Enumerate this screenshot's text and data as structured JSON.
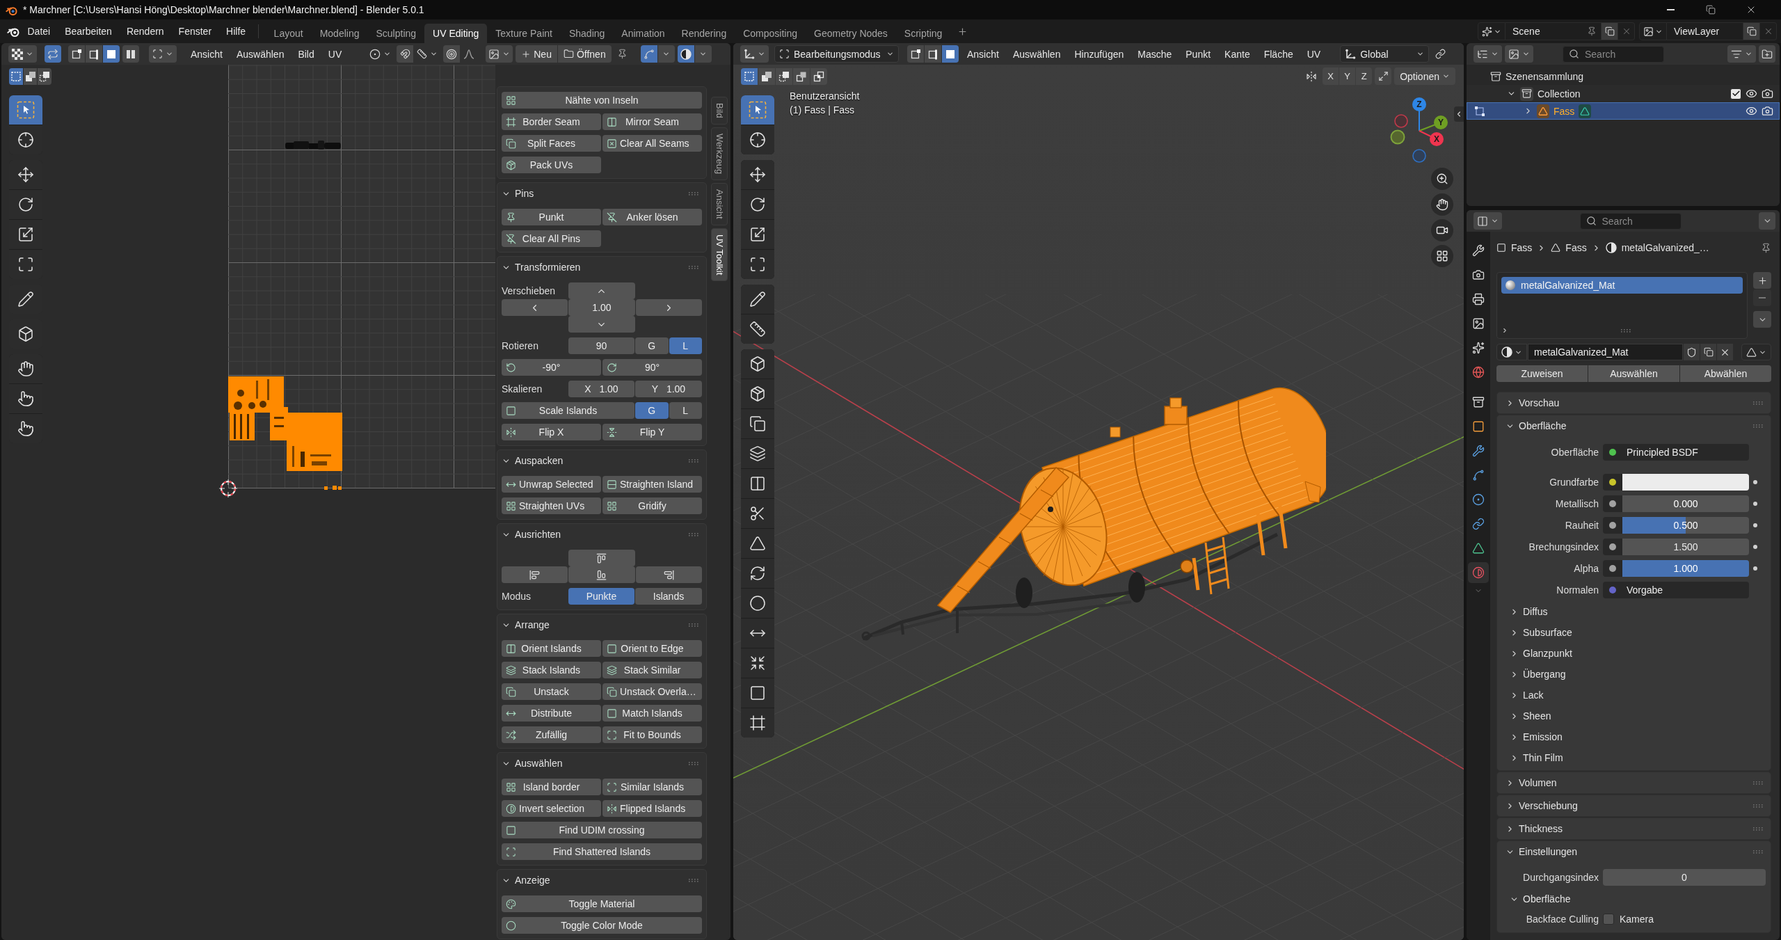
{
  "window": {
    "title": "* Marchner [C:\\Users\\Hansi Höng\\Desktop\\Marchner blender\\Marchner.blend] - Blender 5.0.1"
  },
  "menu": [
    "Datei",
    "Bearbeiten",
    "Rendern",
    "Fenster",
    "Hilfe"
  ],
  "workspaces": [
    {
      "label": "Layout",
      "selected": false
    },
    {
      "label": "Modeling",
      "selected": false
    },
    {
      "label": "Sculpting",
      "selected": false
    },
    {
      "label": "UV Editing",
      "selected": true
    },
    {
      "label": "Texture Paint",
      "selected": false
    },
    {
      "label": "Shading",
      "selected": false
    },
    {
      "label": "Animation",
      "selected": false
    },
    {
      "label": "Rendering",
      "selected": false
    },
    {
      "label": "Compositing",
      "selected": false
    },
    {
      "label": "Geometry Nodes",
      "selected": false
    },
    {
      "label": "Scripting",
      "selected": false
    }
  ],
  "scene": "Scene",
  "view_layer": "ViewLayer",
  "uv_editor": {
    "header": {
      "sync_selection": true,
      "select_modes": [
        {
          "selected": false
        },
        {
          "selected": false
        },
        {
          "selected": true
        },
        {
          "selected": false
        }
      ],
      "menus": [
        "Ansicht",
        "Auswählen",
        "Bild",
        "UV"
      ],
      "new_label": "Neu",
      "open_label": "Öffnen",
      "display_toggles": [
        {
          "on": true
        },
        {
          "on": true
        }
      ]
    },
    "tool_modes": [
      {
        "selected": true
      },
      {
        "selected": false
      },
      {
        "selected": false
      }
    ],
    "tools": [
      {
        "selected": true
      },
      {
        "selected": false
      },
      {
        "selected": false
      },
      {
        "selected": false
      },
      {
        "selected": false
      },
      {
        "selected": false
      },
      {
        "selected": false
      },
      {
        "selected": false
      },
      {
        "selected": false
      },
      {
        "selected": false
      },
      {
        "selected": false
      }
    ],
    "sidebar_tabs": [
      {
        "label": "Bild",
        "selected": false
      },
      {
        "label": "Werkzeug",
        "selected": false
      },
      {
        "label": "Ansicht",
        "selected": false
      },
      {
        "label": "UV Toolkit",
        "selected": true
      }
    ],
    "panels": [
      {
        "rows": [
          {
            "kind": "wide",
            "cells": [
              {
                "kind": "button",
                "label": "Nähte von Inseln",
                "icon": true
              }
            ]
          },
          {
            "kind": "pair",
            "cells": [
              {
                "kind": "button",
                "label": "Border Seam",
                "icon": true
              },
              {
                "kind": "button",
                "label": "Mirror Seam",
                "icon": true
              }
            ]
          },
          {
            "kind": "pair",
            "cells": [
              {
                "kind": "button",
                "label": "Split Faces",
                "icon": true
              },
              {
                "kind": "button",
                "label": "Clear All Seams",
                "icon": true
              }
            ]
          },
          {
            "kind": "pair",
            "cells": [
              {
                "kind": "button",
                "label": "Pack UVs",
                "icon": true
              }
            ]
          }
        ]
      },
      {
        "title": "Pins",
        "expanded": true,
        "rows": [
          {
            "kind": "pair",
            "cells": [
              {
                "kind": "button",
                "label": "Punkt",
                "icon": true
              },
              {
                "kind": "button",
                "label": "Anker lösen",
                "icon": true
              }
            ]
          },
          {
            "kind": "pair",
            "cells": [
              {
                "kind": "button",
                "label": "Clear All Pins",
                "icon": true
              }
            ]
          }
        ]
      },
      {
        "title": "Transformieren",
        "expanded": true,
        "rows": [
          {
            "kind": "pad",
            "label": "Verschieben",
            "cells": [
              {
                "kind": "icon"
              },
              {
                "kind": "icon"
              },
              {
                "kind": "value",
                "text": "1.00"
              },
              {
                "kind": "icon"
              },
              {
                "kind": "icon"
              }
            ]
          },
          {
            "kind": "quad",
            "label": "Rotieren",
            "cells": [
              {
                "kind": "value",
                "text": "90"
              },
              {
                "kind": "button",
                "label": "G",
                "selected": false
              },
              {
                "kind": "button",
                "label": "L",
                "selected": true
              }
            ]
          },
          {
            "kind": "pair",
            "cells": [
              {
                "kind": "button",
                "label": "-90°",
                "icon": true
              },
              {
                "kind": "button",
                "label": "90°",
                "icon": true
              }
            ]
          },
          {
            "kind": "quad",
            "label": "Skalieren",
            "cells": [
              {
                "kind": "value",
                "name": "X",
                "text": "1.00"
              },
              {
                "kind": "value",
                "name": "Y",
                "text": "1.00"
              }
            ]
          },
          {
            "kind": "quad",
            "cells": [
              {
                "kind": "button",
                "label": "Scale Islands",
                "icon": true
              },
              {
                "kind": "button",
                "label": "G",
                "selected": true
              },
              {
                "kind": "button",
                "label": "L",
                "selected": false
              }
            ]
          },
          {
            "kind": "pair",
            "cells": [
              {
                "kind": "button",
                "label": "Flip X",
                "icon": true
              },
              {
                "kind": "button",
                "label": "Flip Y",
                "icon": true
              }
            ]
          }
        ]
      },
      {
        "title": "Auspacken",
        "expanded": true,
        "rows": [
          {
            "kind": "pair",
            "cells": [
              {
                "kind": "button",
                "label": "Unwrap Selected",
                "icon": true
              },
              {
                "kind": "button",
                "label": "Straighten Island",
                "icon": true
              }
            ]
          },
          {
            "kind": "pair",
            "cells": [
              {
                "kind": "button",
                "label": "Straighten UVs",
                "icon": true
              },
              {
                "kind": "button",
                "label": "Gridify",
                "icon": true
              }
            ]
          }
        ]
      },
      {
        "title": "Ausrichten",
        "expanded": true,
        "rows": [
          {
            "kind": "align",
            "cells": [
              {
                "kind": "icon"
              },
              {
                "kind": "icon"
              },
              {
                "kind": "icon"
              },
              {
                "kind": "icon"
              }
            ]
          },
          {
            "kind": "quad",
            "label": "Modus",
            "cells": [
              {
                "kind": "button",
                "label": "Punkte",
                "selected": true
              },
              {
                "kind": "button",
                "label": "Islands",
                "selected": false
              }
            ]
          }
        ]
      },
      {
        "title": "Arrange",
        "expanded": true,
        "rows": [
          {
            "kind": "pair",
            "cells": [
              {
                "kind": "button",
                "label": "Orient Islands",
                "icon": true
              },
              {
                "kind": "button",
                "label": "Orient to Edge",
                "icon": true
              }
            ]
          },
          {
            "kind": "pair",
            "cells": [
              {
                "kind": "button",
                "label": "Stack Islands",
                "icon": true
              },
              {
                "kind": "button",
                "label": "Stack Similar",
                "icon": true
              }
            ]
          },
          {
            "kind": "pair",
            "cells": [
              {
                "kind": "button",
                "label": "Unstack",
                "icon": true
              },
              {
                "kind": "button",
                "label": "Unstack Overla…",
                "icon": true
              }
            ]
          },
          {
            "kind": "pair",
            "cells": [
              {
                "kind": "button",
                "label": "Distribute",
                "icon": true
              },
              {
                "kind": "button",
                "label": "Match Islands",
                "icon": true
              }
            ]
          },
          {
            "kind": "pair",
            "cells": [
              {
                "kind": "button",
                "label": "Zufällig",
                "icon": true
              },
              {
                "kind": "button",
                "label": "Fit to Bounds",
                "icon": true
              }
            ]
          }
        ]
      },
      {
        "title": "Auswählen",
        "expanded": true,
        "rows": [
          {
            "kind": "pair",
            "cells": [
              {
                "kind": "button",
                "label": "Island border",
                "icon": true
              },
              {
                "kind": "button",
                "label": "Similar Islands",
                "icon": true
              }
            ]
          },
          {
            "kind": "pair",
            "cells": [
              {
                "kind": "button",
                "label": "Invert selection",
                "icon": true
              },
              {
                "kind": "button",
                "label": "Flipped Islands",
                "icon": true
              }
            ]
          },
          {
            "kind": "wide",
            "cells": [
              {
                "kind": "button",
                "label": "Find UDIM crossing",
                "icon": true
              }
            ]
          },
          {
            "kind": "wide",
            "cells": [
              {
                "kind": "button",
                "label": "Find Shattered Islands",
                "icon": true
              }
            ]
          }
        ]
      },
      {
        "title": "Anzeige",
        "expanded": true,
        "rows": [
          {
            "kind": "wide",
            "cells": [
              {
                "kind": "button",
                "label": "Toggle Material",
                "icon": true
              }
            ]
          },
          {
            "kind": "wide",
            "cells": [
              {
                "kind": "button",
                "label": "Toggle Color Mode",
                "icon": true
              }
            ]
          }
        ]
      }
    ]
  },
  "viewport": {
    "header": {
      "editor_mode": "Bearbeitungsmodus",
      "select_modes": [
        {
          "selected": false
        },
        {
          "selected": false
        },
        {
          "selected": true
        }
      ],
      "menus": [
        "Ansicht",
        "Auswählen",
        "Hinzufügen",
        "Masche",
        "Punkt",
        "Kante",
        "Fläche",
        "UV"
      ],
      "orientation": "Global"
    },
    "tool_modes": [
      {
        "selected": true
      },
      {
        "selected": false
      },
      {
        "selected": false
      },
      {
        "selected": false
      },
      {
        "selected": false
      }
    ],
    "mirror_axes": [
      {
        "label": "X",
        "selected": false
      },
      {
        "label": "Y",
        "selected": false
      },
      {
        "label": "Z",
        "selected": false
      }
    ],
    "options_label": "Optionen",
    "view_name": "Benutzeransicht",
    "object_info": "(1) Fass | Fass",
    "gizmo_axes": [
      {
        "label": "Z",
        "color": "#2e86e6"
      },
      {
        "label": "Y",
        "color": "#6f9f23"
      },
      {
        "label": "X",
        "color": "#f0354f"
      }
    ],
    "tools": [
      {
        "selected": true
      },
      {
        "selected": false
      },
      {
        "selected": false
      },
      {
        "selected": false
      },
      {
        "selected": false
      },
      {
        "selected": false
      },
      {
        "selected": false
      },
      {
        "selected": false
      },
      {
        "selected": false
      },
      {
        "selected": false
      },
      {
        "selected": false
      },
      {
        "selected": false
      },
      {
        "selected": false
      },
      {
        "selected": false
      },
      {
        "selected": false
      },
      {
        "selected": false
      },
      {
        "selected": false
      },
      {
        "selected": false
      },
      {
        "selected": false
      },
      {
        "selected": false
      },
      {
        "selected": false
      }
    ]
  },
  "outliner": {
    "search": {
      "placeholder": "Search"
    },
    "tree": [
      {
        "kind": "scene_collection",
        "label": "Szenensammlung",
        "selected": false,
        "children": [
          {
            "kind": "collection",
            "label": "Collection",
            "selected": false,
            "expanded": true,
            "checked": true,
            "visible": true,
            "renderable": true,
            "children": [
              {
                "kind": "object",
                "label": "Fass",
                "selected": true,
                "expanded": false,
                "visible": true,
                "renderable": true
              }
            ]
          }
        ]
      }
    ]
  },
  "properties": {
    "search": {
      "placeholder": "Search"
    },
    "tabs": [
      {
        "selected": false
      },
      {
        "selected": false
      },
      {
        "selected": false
      },
      {
        "selected": false
      },
      {
        "selected": false
      },
      {
        "selected": false
      },
      {
        "selected": false
      },
      {
        "selected": false
      },
      {
        "selected": false
      },
      {
        "selected": false
      },
      {
        "selected": false
      },
      {
        "selected": false
      },
      {
        "selected": false
      },
      {
        "selected": true
      }
    ],
    "breadcrumb": [
      "Fass",
      "Fass",
      "metalGalvanized_…"
    ],
    "material_slots": [
      {
        "name": "metalGalvanized_Mat",
        "selected": true
      }
    ],
    "material": "metalGalvanized_Mat",
    "slot_buttons": [
      "Zuweisen",
      "Auswählen",
      "Abwählen"
    ],
    "panels": [
      {
        "title": "Vorschau",
        "expanded": false
      },
      {
        "title": "Oberfläche",
        "expanded": true,
        "rows": [
          {
            "kind": "link",
            "label": "Oberfläche",
            "value": "Principled BSDF",
            "color": "#4fc24f"
          },
          {
            "kind": "color",
            "label": "Grundfarbe",
            "color": "#c8c42a",
            "decorator": true
          },
          {
            "kind": "slider",
            "label": "Metallisch",
            "value": "0.000",
            "level": 0,
            "color": "#a1a1a1",
            "decorator": true
          },
          {
            "kind": "slider",
            "label": "Rauheit",
            "value": "0.500",
            "level": 0.5,
            "color": "#a1a1a1",
            "decorator": true
          },
          {
            "kind": "number",
            "label": "Brechungsindex",
            "value": "1.500",
            "color": "#a1a1a1",
            "decorator": true
          },
          {
            "kind": "slider",
            "label": "Alpha",
            "value": "1.000",
            "level": 1,
            "color": "#a1a1a1",
            "decorator": true
          },
          {
            "kind": "link",
            "label": "Normalen",
            "value": "Vorgabe",
            "color": "#6464c8"
          }
        ],
        "subpanels": [
          {
            "title": "Diffus",
            "expanded": false
          },
          {
            "title": "Subsurface",
            "expanded": false
          },
          {
            "title": "Glanzpunkt",
            "expanded": false
          },
          {
            "title": "Übergang",
            "expanded": false
          },
          {
            "title": "Lack",
            "expanded": false
          },
          {
            "title": "Sheen",
            "expanded": false
          },
          {
            "title": "Emission",
            "expanded": false
          },
          {
            "title": "Thin Film",
            "expanded": false
          }
        ]
      },
      {
        "title": "Volumen",
        "expanded": false
      },
      {
        "title": "Verschiebung",
        "expanded": false
      },
      {
        "title": "Thickness",
        "expanded": false
      },
      {
        "title": "Einstellungen",
        "expanded": true,
        "rows": [
          {
            "kind": "number",
            "label": "Durchgangsindex",
            "value": "0"
          }
        ],
        "subpanels": [
          {
            "title": "Oberfläche",
            "expanded": true,
            "rows": [
              {
                "kind": "checkbox",
                "label": "Backface Culling",
                "text": "Kamera",
                "checked": false
              }
            ]
          }
        ]
      }
    ]
  }
}
